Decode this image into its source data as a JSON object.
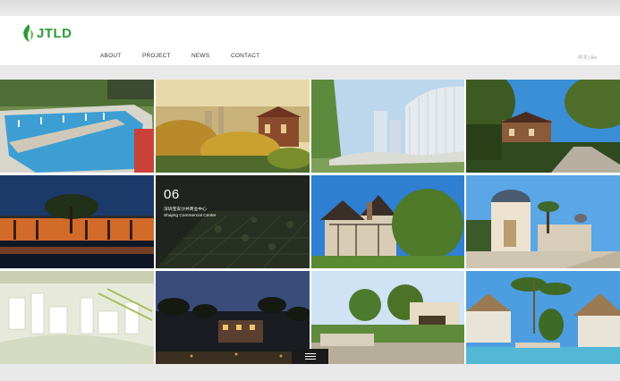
{
  "brand": {
    "logo_text": "JTLD",
    "logo_color": "#2f9b35"
  },
  "nav": {
    "items": [
      "ABOUT",
      "PROJECT",
      "NEWS",
      "CONTACT"
    ]
  },
  "lang": {
    "cn": "中文",
    "sep": "|",
    "en": "En"
  },
  "featured": {
    "number": "06",
    "title_cn": "深圳宝安沙井商业中心",
    "title_en": "Shajing Commercial Center"
  },
  "icons": {
    "menu": "menu-icon",
    "logo": "leaf-logo-icon"
  }
}
